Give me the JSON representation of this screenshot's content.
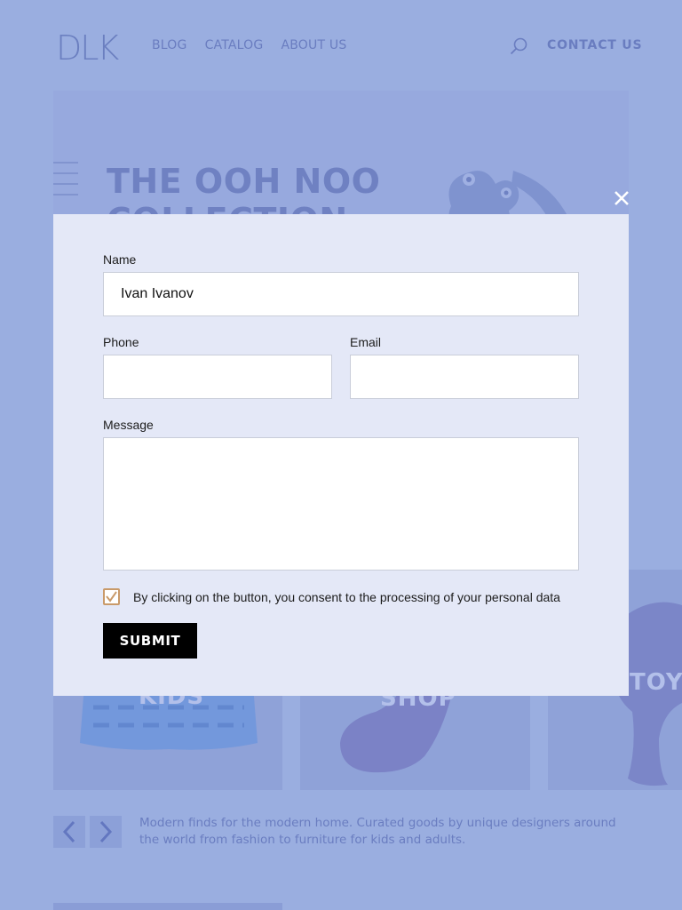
{
  "header": {
    "logo": "DLK",
    "nav": [
      "BLOG",
      "CATALOG",
      "ABOUT US"
    ],
    "search_icon": "search-icon",
    "contact": "CONTACT  US"
  },
  "hero": {
    "title_line1": "THE OOH NOO",
    "title_line2": "COLLECTION"
  },
  "cards": {
    "kids": "KIDS",
    "shop": "SHOP",
    "toys": "TOYS"
  },
  "slider": {
    "prev_icon": "chevron-left-icon",
    "next_icon": "chevron-right-icon",
    "tagline": "Modern finds for the modern home. Curated goods by unique designers around the world from fashion to furniture for kids and adults."
  },
  "modal": {
    "close_icon": "close-icon",
    "name_label": "Name",
    "name_value": "Ivan Ivanov",
    "phone_label": "Phone",
    "phone_value": "",
    "email_label": "Email",
    "email_value": "",
    "message_label": "Message",
    "message_value": "",
    "consent_checked": true,
    "consent_text": "By clicking on the button, you consent to the processing of your personal data",
    "submit_label": "SUBMIT"
  },
  "colors": {
    "overlay": "#9aaee0",
    "modal_bg": "#e4e8f7",
    "checkbox_accent": "#c99a6a",
    "button_bg": "#000000"
  }
}
